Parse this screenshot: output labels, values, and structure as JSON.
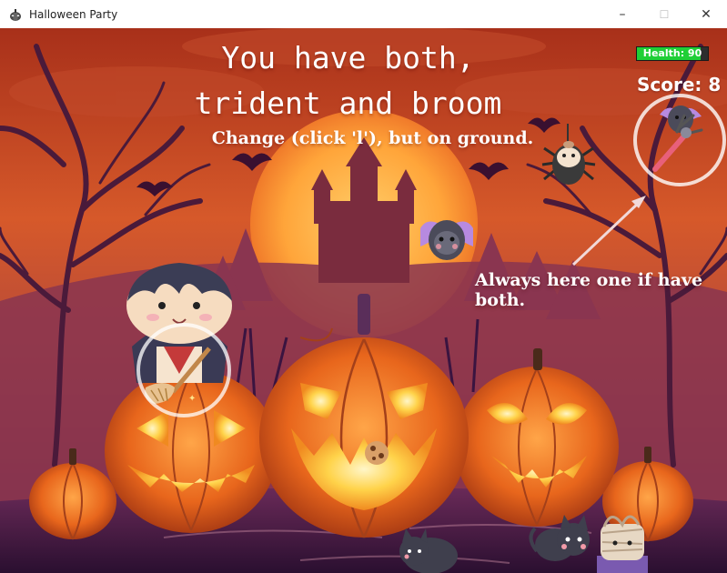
{
  "window": {
    "title": "Halloween Party",
    "controls": {
      "minimize": "–",
      "maximize": "☐",
      "close": "✕"
    }
  },
  "hud": {
    "health_label": "Health: 90",
    "health_value": 90,
    "health_max": 100,
    "score_label": "Score: 8"
  },
  "hint": {
    "line1": "You have both,",
    "line2": "trident and broom",
    "line3": "Change (click 'l'), but on ground."
  },
  "annotation": {
    "text": "Always here one if have both."
  },
  "colors": {
    "sky_top": "#b23a1c",
    "sky_mid": "#e0692a",
    "moon": "#ffb23d",
    "pumpkin": "#e8671d",
    "pumpkin_glow": "#ffd34a",
    "ground": "#3a1640",
    "health_fill": "#1fcf36"
  },
  "icons": {
    "app": "pumpkin-icon",
    "player": "vampire-player",
    "item_in_hand": "broom-icon",
    "item_slot": "trident-icon",
    "enemies": [
      "spider-enemy",
      "bat-enemy",
      "cat-enemy",
      "cat-enemy",
      "mummy-enemy"
    ],
    "pickup": "cookie-icon"
  }
}
